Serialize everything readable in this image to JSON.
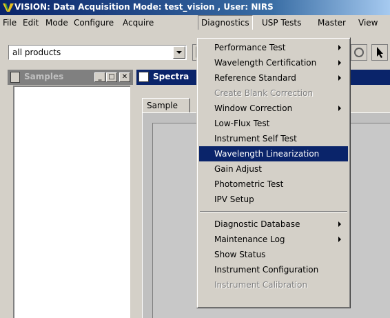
{
  "titlebar": {
    "title": "VISION: Data Acquisition Mode: test_vision , User: NIRS"
  },
  "menubar": {
    "items": [
      {
        "label": "File"
      },
      {
        "label": "Edit"
      },
      {
        "label": "Mode"
      },
      {
        "label": "Configure"
      },
      {
        "label": "Acquire"
      },
      {
        "label": "Diagnostics"
      },
      {
        "label": "USP Tests"
      },
      {
        "label": "Master"
      },
      {
        "label": "View"
      }
    ]
  },
  "toolbar": {
    "product_combo_value": "all products"
  },
  "samples_panel": {
    "title": "Samples",
    "minimize": "_",
    "restore": "□",
    "close": "✕"
  },
  "spectra_window": {
    "title": "Spectra",
    "tab_label": "Sample"
  },
  "diagnostics_menu": {
    "items": [
      {
        "label": "Performance Test",
        "submenu": true
      },
      {
        "label": "Wavelength Certification",
        "submenu": true
      },
      {
        "label": "Reference Standard",
        "submenu": true
      },
      {
        "label": "Create Blank Correction",
        "disabled": true
      },
      {
        "label": "Window Correction",
        "submenu": true
      },
      {
        "label": "Low-Flux Test"
      },
      {
        "label": "Instrument Self Test"
      },
      {
        "label": "Wavelength Linearization",
        "highlighted": true
      },
      {
        "label": "Gain Adjust"
      },
      {
        "label": "Photometric Test"
      },
      {
        "label": "IPV Setup"
      },
      {
        "label": "Diagnostic Database",
        "submenu": true
      },
      {
        "label": "Maintenance Log",
        "submenu": true
      },
      {
        "label": "Show Status"
      },
      {
        "label": "Instrument Configuration"
      },
      {
        "label": "Instrument Calibration",
        "disabled": true
      }
    ]
  },
  "colors": {
    "selection": "#0a246a",
    "titlebar": "#0a246a",
    "face": "#d4d0c8"
  }
}
